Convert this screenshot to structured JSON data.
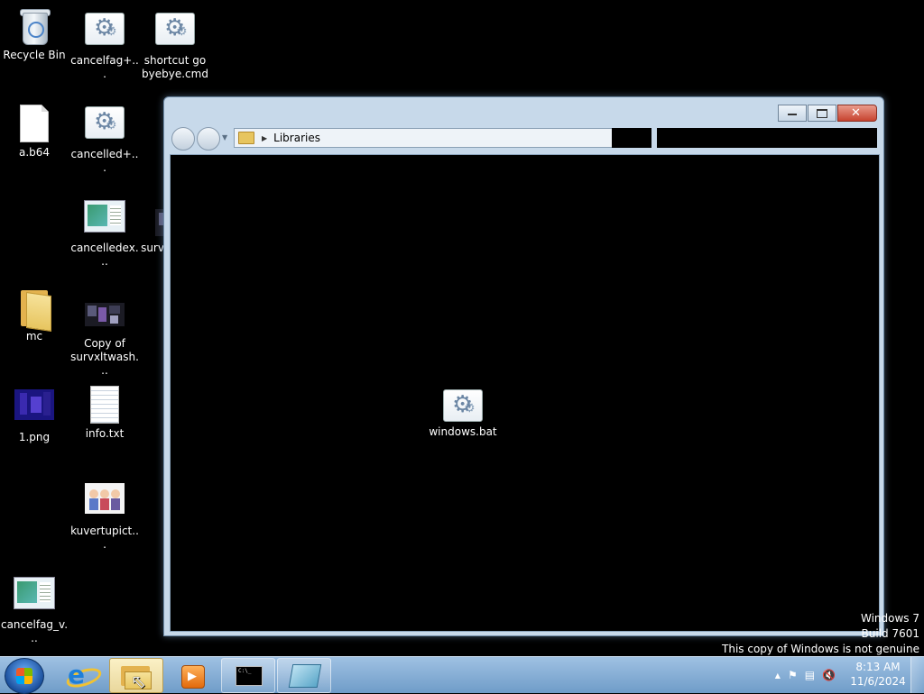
{
  "desktop": {
    "icons": [
      {
        "label": "Recycle Bin"
      },
      {
        "label": "cancelfag+..."
      },
      {
        "label": "shortcut go byebye.cmd"
      },
      {
        "label": "a.b64"
      },
      {
        "label": "cancelled+..."
      },
      {
        "label": "cancelledex..."
      },
      {
        "label": "survxltwash..."
      },
      {
        "label": "mc"
      },
      {
        "label": "Copy of survxltwash..."
      },
      {
        "label": "1.png"
      },
      {
        "label": "info.txt"
      },
      {
        "label": "kuvertupict..."
      },
      {
        "label": "cancelfag_v..."
      }
    ]
  },
  "explorer": {
    "breadcrumb": "Libraries",
    "files": [
      {
        "label": "windows.bat"
      }
    ]
  },
  "watermark": {
    "line1": "Windows 7",
    "line2": "Build 7601",
    "line3": "This copy of Windows is not genuine"
  },
  "taskbar": {
    "clock_time": "8:13 AM",
    "clock_date": "11/6/2024",
    "tray_arrow": "▲"
  },
  "colors": {
    "desktop_bg": "#000000",
    "taskbar": "#7fa8d0",
    "window_frame": "#c7d9ea"
  }
}
